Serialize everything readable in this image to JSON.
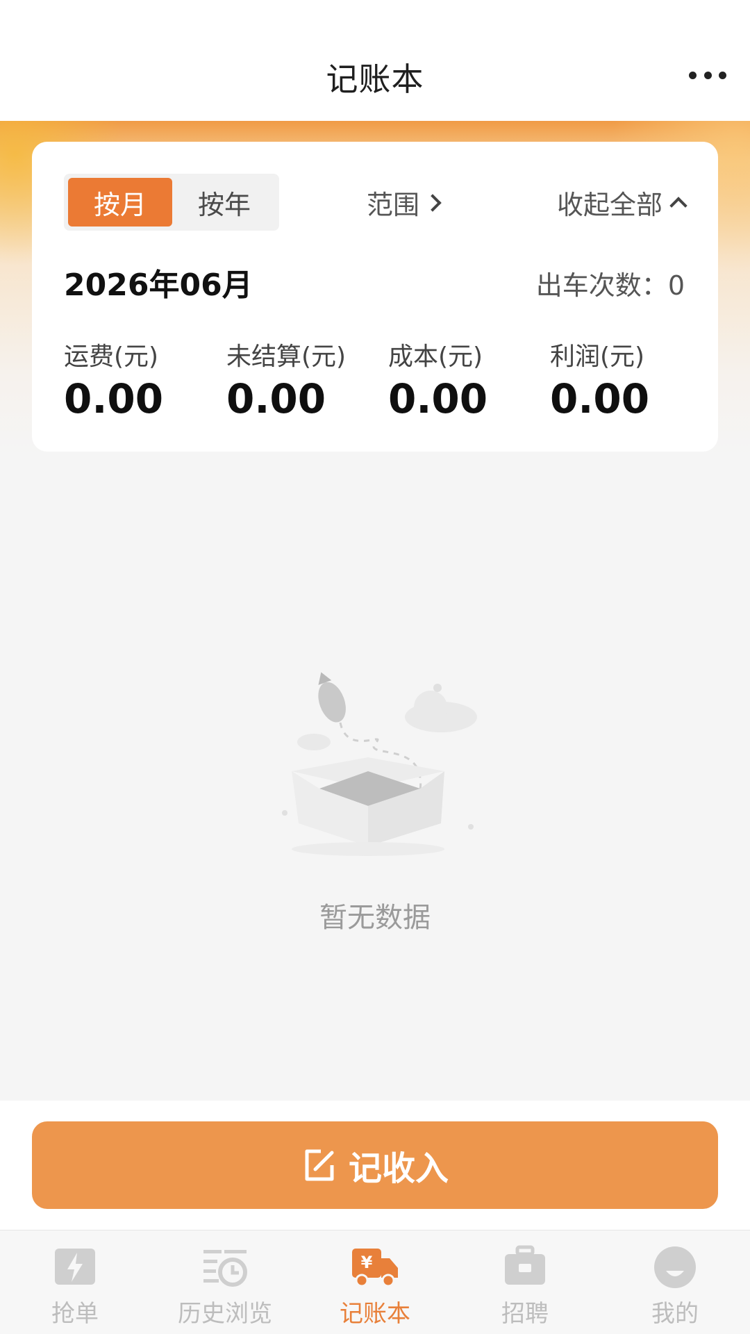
{
  "header": {
    "title": "记账本"
  },
  "summary": {
    "segments": [
      "按月",
      "按年"
    ],
    "range_label": "范围",
    "collapse_label": "收起全部",
    "period": "2026年06月",
    "trips_label": "出车次数：",
    "trips_value": "0",
    "stats": [
      {
        "label": "运费(元)",
        "value": "0.00"
      },
      {
        "label": "未结算(元)",
        "value": "0.00"
      },
      {
        "label": "成本(元)",
        "value": "0.00"
      },
      {
        "label": "利润(元)",
        "value": "0.00"
      }
    ]
  },
  "empty_state": {
    "text": "暂无数据"
  },
  "action": {
    "label": "记收入"
  },
  "tabbar": {
    "items": [
      {
        "label": "抢单",
        "icon": "lightning-icon"
      },
      {
        "label": "历史浏览",
        "icon": "history-icon"
      },
      {
        "label": "记账本",
        "icon": "truck-yen-icon"
      },
      {
        "label": "招聘",
        "icon": "briefcase-icon"
      },
      {
        "label": "我的",
        "icon": "profile-icon"
      }
    ],
    "active_index": 2
  },
  "colors": {
    "accent": "#eb7a34",
    "button": "#ed964d",
    "tab_inactive": "#bdbdbd",
    "tab_active": "#e8803a"
  }
}
